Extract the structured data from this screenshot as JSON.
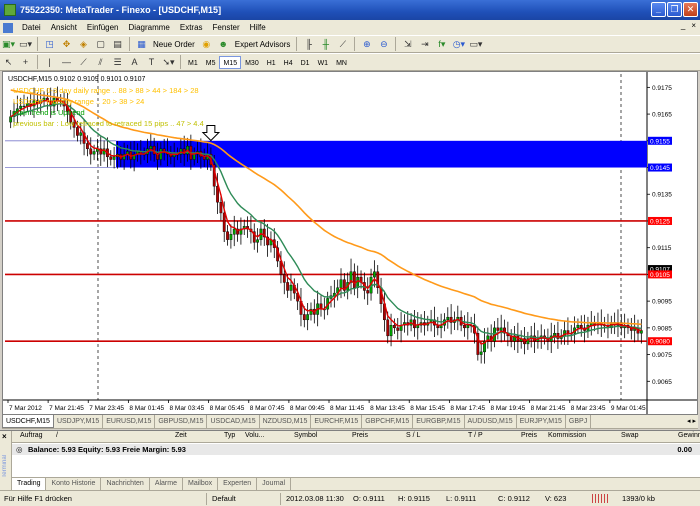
{
  "window": {
    "title": "75522350: MetaTrader - Finexo - [USDCHF,M15]"
  },
  "menu": [
    "Datei",
    "Ansicht",
    "Einfügen",
    "Diagramme",
    "Extras",
    "Fenster",
    "Hilfe"
  ],
  "mdi_controls": [
    "_",
    "×"
  ],
  "toolbar": {
    "new_order": "Neue Order",
    "expert_advisors": "Expert Advisors",
    "timeframes": [
      "M1",
      "M5",
      "M15",
      "M30",
      "H1",
      "H4",
      "D1",
      "W1",
      "MN"
    ],
    "active_timeframe": "M15"
  },
  "chart": {
    "header": "USDCHF,M15  0.9102 0.9109 0.9101 0.9107",
    "overlay_lines": [
      {
        "text": "USDCHF 0-3 day daily range  ..  88 > 88 > 44 > 184 > 28",
        "color": "#ffc000"
      },
      {
        "text": "USDCHF monthly range  ..  20 > 38 > 24",
        "color": "#ffc000"
      },
      {
        "text": "main trend is Uptrend",
        "color": "#00a000"
      },
      {
        "text": "previous bar : Low retraced to retraced 15 pips  ..  47 > 4.4",
        "color": "#c0c000"
      }
    ]
  },
  "chart_data": {
    "type": "candlestick",
    "symbol": "USDCHF",
    "timeframe": "M15",
    "ylim": [
      0.9058,
      0.918
    ],
    "y_ticks": [
      0.9175,
      0.9165,
      0.9155,
      0.9145,
      0.9135,
      0.9125,
      0.9115,
      0.9105,
      0.9095,
      0.9085,
      0.9075,
      0.9065
    ],
    "x_ticks": [
      "7 Mar 2012",
      "7 Mar 21:45",
      "7 Mar 23:45",
      "8 Mar 01:45",
      "8 Mar 03:45",
      "8 Mar 05:45",
      "8 Mar 07:45",
      "8 Mar 09:45",
      "8 Mar 11:45",
      "8 Mar 13:45",
      "8 Mar 15:45",
      "8 Mar 17:45",
      "8 Mar 19:45",
      "8 Mar 21:45",
      "8 Mar 23:45",
      "9 Mar 01:45"
    ],
    "price_labels": [
      {
        "value": 0.9155,
        "text": "0.9155",
        "bg": "#0000ff",
        "fg": "#ffffff"
      },
      {
        "value": 0.9145,
        "text": "0.9145",
        "bg": "#0000ff",
        "fg": "#ffffff"
      },
      {
        "value": 0.9125,
        "text": "0.9125",
        "bg": "#ff0000",
        "fg": "#ffffff"
      },
      {
        "value": 0.9107,
        "text": "0.9107",
        "bg": "#000000",
        "fg": "#ffffff"
      },
      {
        "value": 0.9105,
        "text": "0.9105",
        "bg": "#ff0000",
        "fg": "#ffffff"
      },
      {
        "value": 0.908,
        "text": "0.9080",
        "bg": "#ff0000",
        "fg": "#ffffff"
      }
    ],
    "horizontal_levels": [
      0.9125,
      0.9105,
      0.908
    ],
    "zone": {
      "top": 0.9155,
      "bottom": 0.9145,
      "color": "#0000ff"
    },
    "arrow_candle_index": 60,
    "colors": {
      "bull": "#00a000",
      "bear": "#b00000",
      "ma_fast": "#e00000",
      "ma_mid": "#2e8b57",
      "ma_slow": "#ff9a1a",
      "level": "#cc0000"
    },
    "series": [
      {
        "name": "close",
        "values": [
          0.9164,
          0.9166,
          0.9167,
          0.9168,
          0.9168,
          0.9169,
          0.9168,
          0.917,
          0.9169,
          0.917,
          0.9171,
          0.917,
          0.9168,
          0.9171,
          0.917,
          0.917,
          0.9168,
          0.9166,
          0.9162,
          0.916,
          0.9157,
          0.9158,
          0.9154,
          0.9152,
          0.915,
          0.9151,
          0.9152,
          0.915,
          0.9152,
          0.9149,
          0.9148,
          0.9149,
          0.915,
          0.9148,
          0.915,
          0.9151,
          0.9148,
          0.915,
          0.9151,
          0.915,
          0.915,
          0.9152,
          0.9153,
          0.915,
          0.9148,
          0.9152,
          0.9151,
          0.915,
          0.9149,
          0.915,
          0.915,
          0.9152,
          0.915,
          0.9153,
          0.9148,
          0.915,
          0.9151,
          0.9149,
          0.9148,
          0.915,
          0.9146,
          0.9138,
          0.9132,
          0.9128,
          0.9121,
          0.9118,
          0.912,
          0.9122,
          0.912,
          0.9122,
          0.9123,
          0.9122,
          0.9121,
          0.9117,
          0.9118,
          0.9122,
          0.9119,
          0.9116,
          0.9118,
          0.9115,
          0.911,
          0.9105,
          0.9102,
          0.9099,
          0.9101,
          0.9098,
          0.9095,
          0.909,
          0.9088,
          0.909,
          0.9092,
          0.909,
          0.9094,
          0.9092,
          0.9092,
          0.9096,
          0.9097,
          0.9098,
          0.91,
          0.9103,
          0.9099,
          0.9102,
          0.9106,
          0.91,
          0.9104,
          0.9102,
          0.9099,
          0.9098,
          0.9104,
          0.9106,
          0.91,
          0.9094,
          0.9088,
          0.9082,
          0.9086,
          0.9085,
          0.9084,
          0.9086,
          0.9087,
          0.9086,
          0.9088,
          0.9085,
          0.9086,
          0.9087,
          0.9086,
          0.9087,
          0.9088,
          0.9086,
          0.9085,
          0.9086,
          0.9088,
          0.9089,
          0.9087,
          0.9088,
          0.9089,
          0.9086,
          0.9085,
          0.9086,
          0.9086,
          0.9083,
          0.9075,
          0.9076,
          0.908,
          0.9082,
          0.908,
          0.9085,
          0.9084,
          0.9085,
          0.9083,
          0.9082,
          0.908,
          0.9082,
          0.908,
          0.9081,
          0.9079,
          0.9081,
          0.9082,
          0.908,
          0.9081,
          0.9082,
          0.9081,
          0.908,
          0.9082,
          0.9083,
          0.9081,
          0.9082,
          0.9084,
          0.9083,
          0.9083,
          0.9085,
          0.9086,
          0.9085,
          0.9084,
          0.9086,
          0.9087,
          0.9086,
          0.9087,
          0.9086,
          0.9086,
          0.9085,
          0.9087,
          0.9086,
          0.9087,
          0.9085,
          0.9086,
          0.9085,
          0.9084,
          0.9085,
          0.9083,
          0.9084
        ]
      }
    ]
  },
  "chart_tabs": [
    "USDCHF,M15",
    "USDJPY,M15",
    "EURUSD,M15",
    "GBPUSD,M15",
    "USDCAD,M15",
    "NZDUSD,M15",
    "EURCHF,M15",
    "GBPCHF,M15",
    "EURGBP,M15",
    "AUDUSD,M15",
    "EURJPY,M15",
    "GBPJ"
  ],
  "terminal": {
    "side_label": "Terminal",
    "columns": [
      "Auftrag",
      "/",
      "Zeit",
      "Typ",
      "Volu...",
      "Symbol",
      "Preis",
      "S / L",
      "T / P",
      "Preis",
      "Kommission",
      "Swap",
      "Gewinn"
    ],
    "balance_text": "Balance: 5.93  Equity: 5.93  Freie Margin: 5.93",
    "profit": "0.00",
    "tabs": [
      "Trading",
      "Konto Historie",
      "Nachrichten",
      "Alarme",
      "Mailbox",
      "Experten",
      "Journal"
    ]
  },
  "status": {
    "help": "Für Hilfe F1 drücken",
    "profile": "Default",
    "datetime": "2012.03.08 11:30",
    "open": "O: 0.9111",
    "high": "H: 0.9115",
    "low": "L: 0.9111",
    "close": "C: 0.9112",
    "volume": "V: 623",
    "traffic": "1393/0 kb"
  }
}
